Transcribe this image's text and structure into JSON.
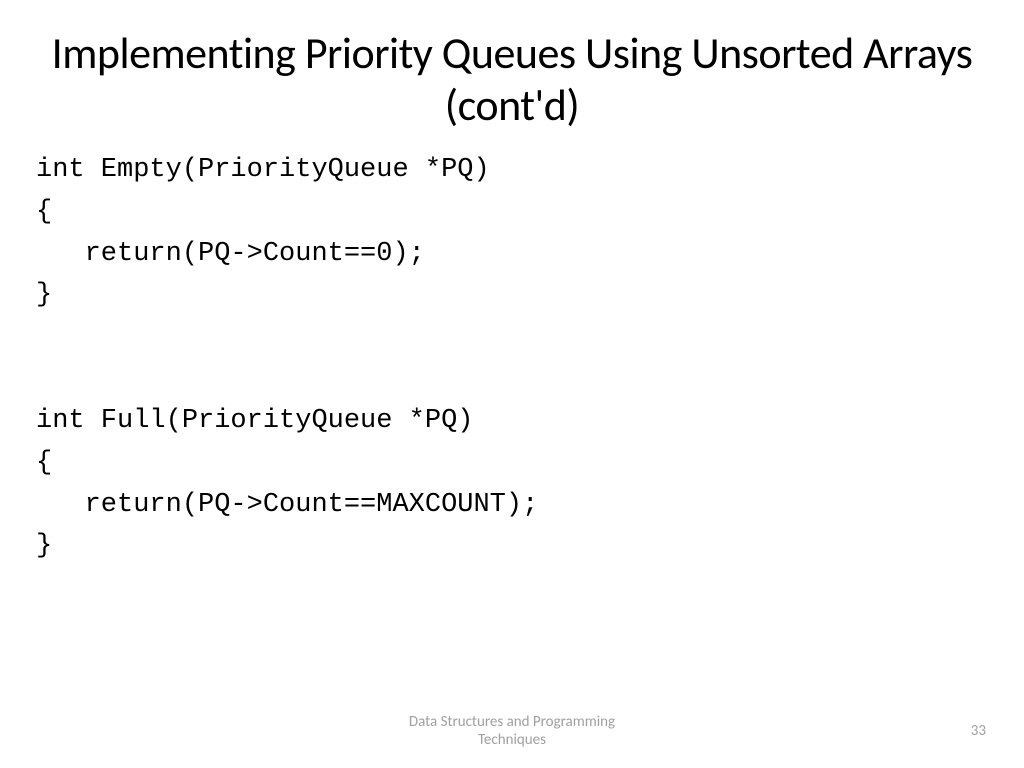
{
  "title": "Implementing Priority Queues Using Unsorted Arrays (cont'd)",
  "code": {
    "l1": "int Empty(PriorityQueue *PQ)",
    "l2": "{",
    "l3": "   return(PQ->Count==0);",
    "l4": "}",
    "l5": "",
    "l6": "",
    "l7": "int Full(PriorityQueue *PQ)",
    "l8": "{",
    "l9": "   return(PQ->Count==MAXCOUNT);",
    "l10": "}"
  },
  "footer": {
    "line1": "Data Structures and Programming",
    "line2": "Techniques"
  },
  "page_number": "33"
}
